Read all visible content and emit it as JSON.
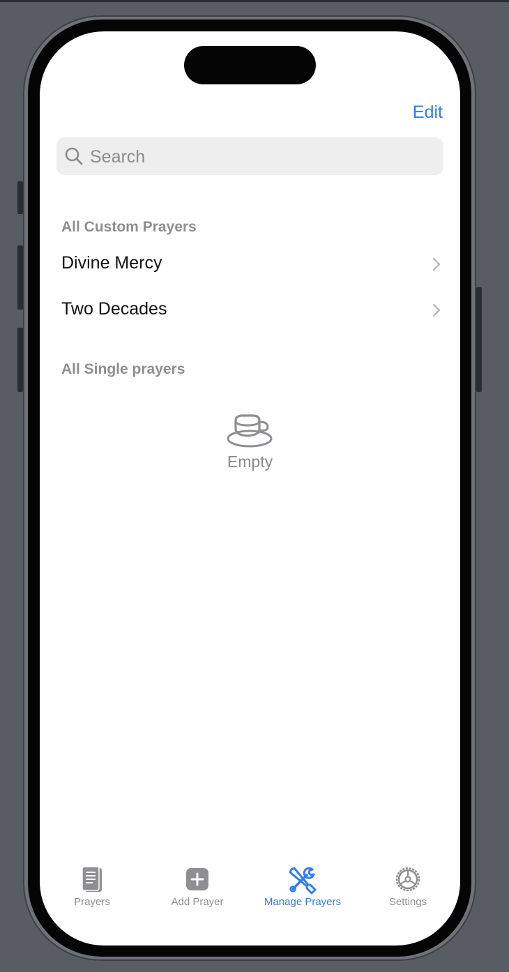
{
  "nav": {
    "edit_label": "Edit"
  },
  "search": {
    "placeholder": "Search",
    "value": ""
  },
  "sections": {
    "custom": {
      "title": "All Custom Prayers",
      "items": [
        {
          "label": "Divine Mercy"
        },
        {
          "label": "Two Decades"
        }
      ]
    },
    "single": {
      "title": "All Single prayers",
      "empty_label": "Empty",
      "empty_icon": "cup-and-saucer-icon"
    }
  },
  "tabs": [
    {
      "label": "Prayers",
      "icon": "book-icon",
      "active": false
    },
    {
      "label": "Add Prayer",
      "icon": "plus-square-icon",
      "active": false
    },
    {
      "label": "Manage Prayers",
      "icon": "wrench-screwdriver-icon",
      "active": true
    },
    {
      "label": "Settings",
      "icon": "gear-icon",
      "active": false
    }
  ],
  "colors": {
    "accent": "#2f7cf6",
    "secondary_text": "#8e8e92",
    "search_background": "#eeeeef"
  }
}
